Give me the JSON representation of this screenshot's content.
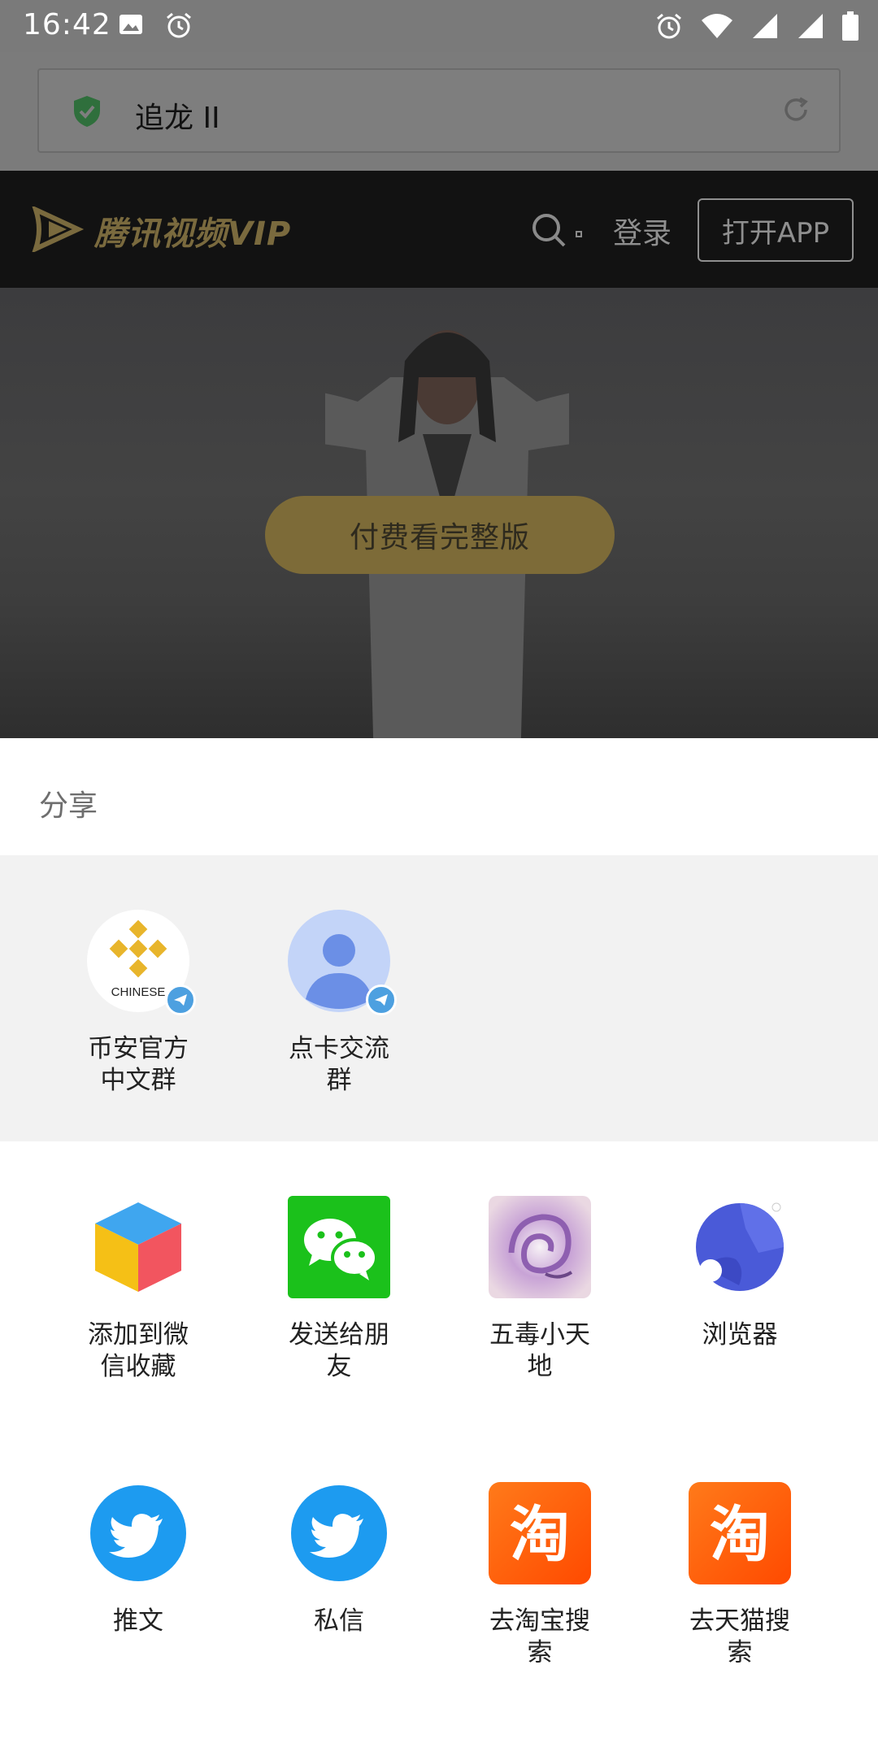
{
  "status_bar": {
    "time": "16:42",
    "left_icons": [
      "image-icon",
      "alarm-icon"
    ],
    "right_icons": [
      "alarm-icon",
      "wifi-icon",
      "signal-icon",
      "signal-icon",
      "battery-icon"
    ]
  },
  "browser": {
    "page_title": "追龙 II"
  },
  "site": {
    "logo_text": "腾讯视频VIP",
    "login_label": "登录",
    "open_app_label": "打开APP",
    "pay_button_label": "付费看完整版",
    "accent_color": "#7d6b38"
  },
  "share_sheet": {
    "title": "分享",
    "contacts": [
      {
        "label": "币安官方\n中文群",
        "icon": "binance-chinese-icon",
        "logo_text": "CHINESE",
        "badge": "telegram-icon"
      },
      {
        "label": "点卡交流\n群",
        "icon": "person-avatar-icon",
        "badge": "telegram-icon"
      }
    ],
    "apps_row1": [
      {
        "label": "添加到微\n信收藏",
        "icon": "wechat-favorites-icon"
      },
      {
        "label": "发送给朋\n友",
        "icon": "wechat-icon"
      },
      {
        "label": "五毒小天\n地",
        "icon": "wudu-app-icon"
      },
      {
        "label": "浏览器",
        "icon": "browser-icon"
      }
    ],
    "apps_row2": [
      {
        "label": "推文",
        "icon": "twitter-icon"
      },
      {
        "label": "私信",
        "icon": "twitter-icon"
      },
      {
        "label": "去淘宝搜\n索",
        "icon": "taobao-icon",
        "logo_text": "淘"
      },
      {
        "label": "去天猫搜\n索",
        "icon": "taobao-icon",
        "logo_text": "淘"
      }
    ]
  }
}
